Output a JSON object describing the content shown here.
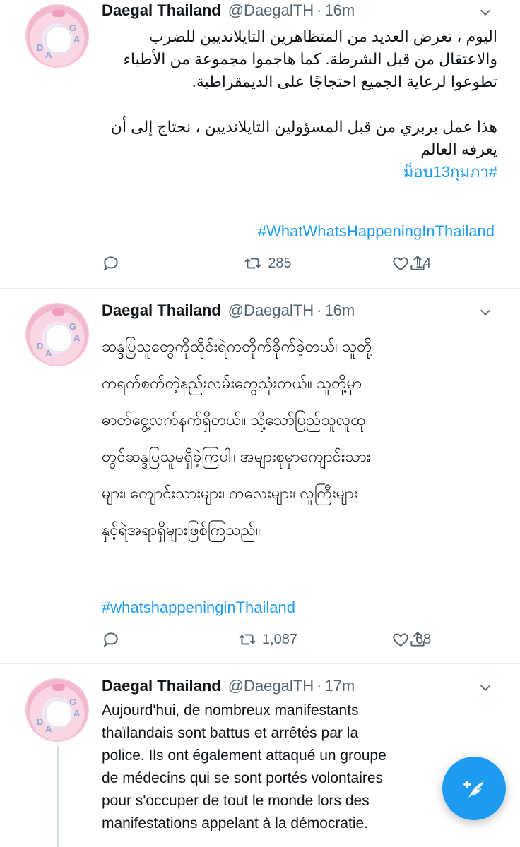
{
  "tweets": [
    {
      "name": "Daegal Thailand",
      "handle": "@DaegalTH",
      "dot": "·",
      "time": "16m",
      "paragraphs": [
        "اليوم ، تعرض العديد من المتظاهرين التايلانديين للضرب والاعتقال من قبل الشرطة. كما هاجموا مجموعة من الأطباء تطوعوا لرعاية الجميع احتجاجًا على الديمقراطية.",
        "هذا عمل بربري من قبل المسؤولين التايلانديين ، نحتاج إلى أن يعرفه العالم"
      ],
      "hashtags": [
        "#ม็อบ13กุมภา",
        "#WhatWhatsHappeningInThailand"
      ],
      "retweets": "285",
      "likes": "14"
    },
    {
      "name": "Daegal Thailand",
      "handle": "@DaegalTH",
      "dot": "·",
      "time": "16m",
      "lines": [
        "ဆန္ဒပြသူတွေကိုထိုင်းရဲကတိုက်ခိုက်ခဲ့တယ်၊ သူတို့",
        "ကရက်စက်တဲ့နည်းလမ်းတွေသုံးတယ်။ သူတို့မှာ",
        "ဓာတ်ငွေ့လက်နက်ရှိတယ်။ သို့သော်ပြည်သူလူထု",
        "တွင်ဆန္ဒပြသူမရှိခဲ့ကြပါ။ အများစုမှာကျောင်းသား",
        "များ၊ ကျောင်းသားများ၊ ကလေးများ၊ လူကြီးများ",
        "နှင့်ရဲအရာရှိများဖြစ်ကြသည်။"
      ],
      "hashtag": "#whatshappeninginThailand",
      "retweets": "1,087",
      "likes": "68"
    },
    {
      "name": "Daegal Thailand",
      "handle": "@DaegalTH",
      "dot": "·",
      "time": "17m",
      "lines": [
        "Aujourd'hui, de nombreux manifestants",
        "thaïlandais sont battus et arrêtés par la",
        "police.  Ils ont également attaqué un groupe",
        "de médecins qui se sont portés volontaires",
        "pour s'occuper de tout le monde lors des",
        "manifestations appelant à la démocratie."
      ]
    }
  ],
  "avatar_letters": [
    "D",
    "A",
    "G",
    "A"
  ],
  "colors": {
    "link": "#1d9bf0",
    "muted": "#536471",
    "divider": "#e6ecf0",
    "fab": "#1d9bf0"
  },
  "icons": {
    "reply": "reply-icon",
    "retweet": "retweet-icon",
    "like": "heart-icon",
    "share": "share-icon",
    "more": "chevron-down-icon",
    "compose": "compose-tweet-icon"
  }
}
